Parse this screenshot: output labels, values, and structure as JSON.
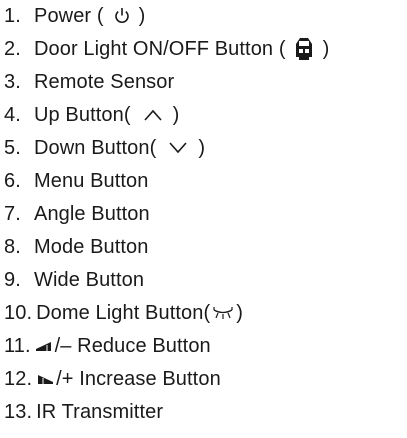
{
  "items": [
    {
      "num": "1.",
      "before": "Power (",
      "icon": "power-icon",
      "after": ")"
    },
    {
      "num": "2.",
      "before": "Door Light ON/OFF Button (",
      "icon": "car-door-icon",
      "after": ")"
    },
    {
      "num": "3.",
      "label": "Remote Sensor"
    },
    {
      "num": "4.",
      "before": "Up Button(",
      "icon": "chevron-up-icon",
      "after": ")"
    },
    {
      "num": "5.",
      "before": "Down Button(",
      "icon": "chevron-down-icon",
      "after": ")"
    },
    {
      "num": "6.",
      "label": "Menu Button"
    },
    {
      "num": "7.",
      "label": "Angle Button"
    },
    {
      "num": "8.",
      "label": "Mode Button"
    },
    {
      "num": "9.",
      "label": "Wide Button"
    },
    {
      "num": "10.",
      "before": "Dome Light Button(",
      "icon": "dome-light-icon",
      "after": ")"
    },
    {
      "num": "11.",
      "icon": "volume-decrease-icon",
      "after": "/– Reduce Button"
    },
    {
      "num": "12.",
      "icon": "volume-increase-icon",
      "after": "/+ Increase Button"
    },
    {
      "num": "13.",
      "label": "IR Transmitter"
    }
  ]
}
